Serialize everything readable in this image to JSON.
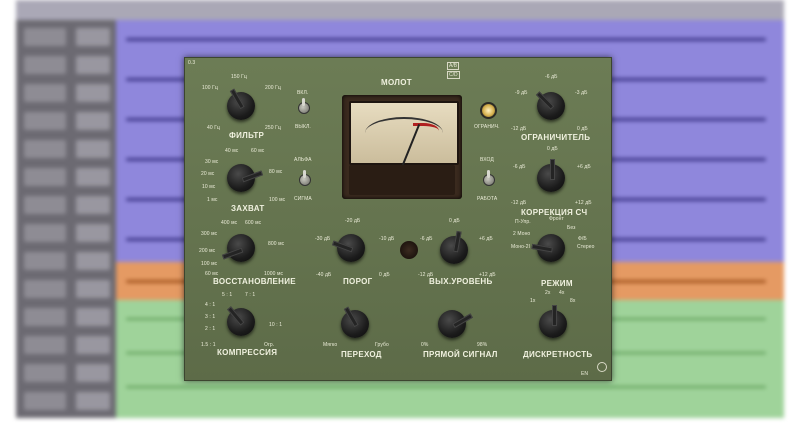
{
  "plugin": {
    "version": "0.3",
    "title": "МОЛОТ",
    "lang": "EN",
    "filter": {
      "title": "ФИЛЬТР",
      "t0": "100 Гц",
      "t1": "150 Гц",
      "t2": "200 Гц",
      "t3": "40 Гц",
      "t4": "250 Гц"
    },
    "power": {
      "on": "ВКЛ.",
      "off": "ВЫКЛ."
    },
    "attack": {
      "title": "ЗАХВАТ",
      "t0": "40 мс",
      "t1": "60 мс",
      "t2": "30 мс",
      "t3": "80 мс",
      "t4": "20 мс",
      "t5": "10 мс",
      "t6": "100 мс",
      "t7": "1 мс"
    },
    "mode_ab": {
      "alpha": "АЛЬФА",
      "sigma": "СИГМА"
    },
    "release": {
      "title": "ВОССТАНОВЛЕНИЕ",
      "t0": "400 мс",
      "t1": "600 мс",
      "t2": "300 мс",
      "t3": "800 мс",
      "t4": "200 мс",
      "t5": "100 мс",
      "t6": "60 мс",
      "t7": "1000 мс"
    },
    "threshold": {
      "title": "ПОРОГ",
      "t0": "-20 дБ",
      "t1": "-30 дБ",
      "t2": "-10 дБ",
      "t3": "-40 дБ",
      "t4": "0 дБ"
    },
    "output": {
      "title": "ВЫХ.УРОВЕНЬ",
      "t0": "0 дБ",
      "t1": "-6 дБ",
      "t2": "+6 дБ",
      "t3": "-12 дБ",
      "t4": "+12 дБ"
    },
    "compression": {
      "title": "КОМПРЕССИЯ",
      "t0": "5 : 1",
      "t1": "7 : 1",
      "t2": "4 : 1",
      "t3": "3 : 1",
      "t4": "10 : 1",
      "t5": "2 : 1",
      "t6": "1.5 : 1",
      "t7": "Огр."
    },
    "transition": {
      "title": "ПЕРЕХОД",
      "t0": "Мягко",
      "t1": "Грубо"
    },
    "dry": {
      "title": "ПРЯМОЙ СИГНАЛ",
      "t0": "0%",
      "t1": "98%"
    },
    "limiter": {
      "title": "ОГРАНИЧИТЕЛЬ",
      "lamp": "ОГРАНИЧ.",
      "t0": "-6 дБ",
      "t1": "-9 дБ",
      "t2": "-3 дБ",
      "t3": "-12 дБ",
      "t4": "0 дБ"
    },
    "input": {
      "in": "ВХОД",
      "work": "РАБОТА"
    },
    "lowcorr": {
      "title": "КОРРЕКЦИЯ СЧ",
      "t0": "0 дБ",
      "t1": "-6 дБ",
      "t2": "+6 дБ",
      "t3": "-12 дБ",
      "t4": "+12 дБ"
    },
    "mode": {
      "title": "РЕЖИМ",
      "t0": "П-Упр.",
      "t1": "Фронт",
      "t2": "2 Моно",
      "t3": "Без",
      "t4": "Ф/Б",
      "t5": "Моно-2I",
      "t6": "Стерео"
    },
    "discrete": {
      "title": "ДИСКРЕТНОСТЬ",
      "t0": "2x",
      "t1": "4x",
      "t2": "1x",
      "t3": "8x"
    }
  }
}
